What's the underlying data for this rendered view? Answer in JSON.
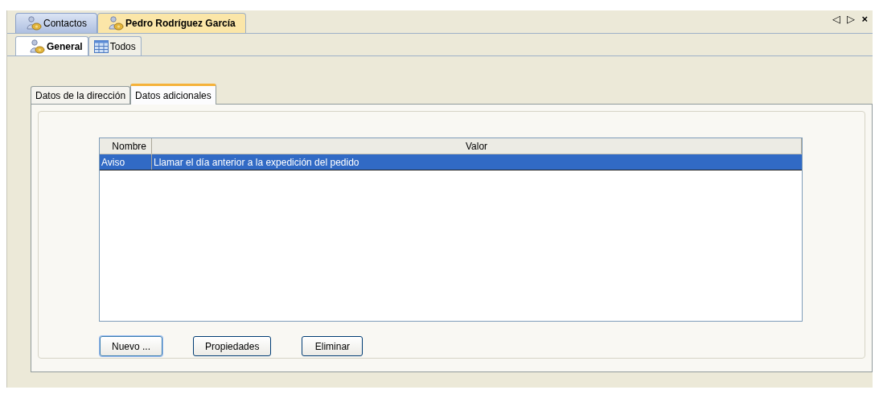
{
  "document_tabs": [
    {
      "label": "Contactos",
      "kind": "contact",
      "selected": false
    },
    {
      "label": "Pedro Rodríguez García",
      "kind": "contact",
      "selected": true
    }
  ],
  "window_controls": [
    "◁",
    "▷",
    "×"
  ],
  "view_tabs": [
    {
      "label": "General",
      "kind": "contact",
      "selected": true
    },
    {
      "label": "Todos",
      "kind": "grid",
      "selected": false
    }
  ],
  "section_tabs": [
    {
      "label": "Datos de la dirección",
      "selected": false
    },
    {
      "label": "Datos adicionales",
      "selected": true
    }
  ],
  "table": {
    "columns": [
      "Nombre",
      "Valor"
    ],
    "rows": [
      {
        "cells": [
          "Aviso",
          "Llamar el día anterior a la expedición del pedido"
        ],
        "selected": true
      }
    ]
  },
  "buttons": [
    {
      "label": "Nuevo ...",
      "default": true
    },
    {
      "label": "Propiedades",
      "default": false
    },
    {
      "label": "Eliminar",
      "default": false
    }
  ]
}
